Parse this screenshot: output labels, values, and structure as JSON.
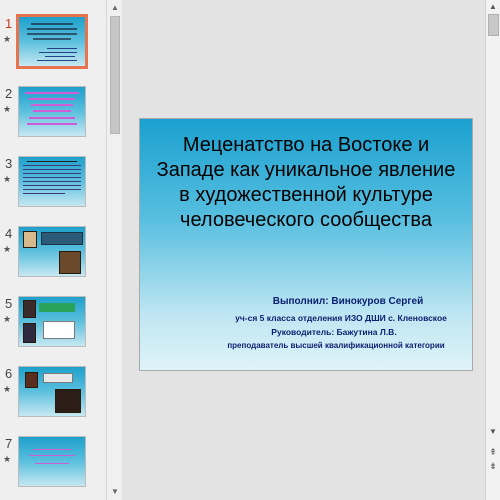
{
  "thumbnails": [
    {
      "number": "1",
      "star": "★",
      "active": true
    },
    {
      "number": "2",
      "star": "★",
      "active": false
    },
    {
      "number": "3",
      "star": "★",
      "active": false
    },
    {
      "number": "4",
      "star": "★",
      "active": false
    },
    {
      "number": "5",
      "star": "★",
      "active": false
    },
    {
      "number": "6",
      "star": "★",
      "active": false
    },
    {
      "number": "7",
      "star": "★",
      "active": false
    }
  ],
  "slide": {
    "title": "Меценатство на Востоке и Западе как уникальное явление в художественной культуре человеческого сообщества",
    "author": "Выполнил: Винокуров Сергей",
    "student_line": "уч-ся 5 класса  отделения  ИЗО  ДШИ с. Кленовское",
    "supervisor": "Руководитель: Бажутина Л.В.",
    "supervisor_role": "преподаватель высшей квалификационной категории"
  },
  "colors": {
    "active_thumb_border": "#e8744f",
    "active_number": "#c43b1d",
    "slide_gradient_top": "#1ba0cf",
    "slide_gradient_bottom": "#dff3f8",
    "subtitle_text": "#0a1f6e"
  },
  "icons": {
    "scroll_up": "▲",
    "scroll_down": "▼",
    "prev_slide": "⇞",
    "next_slide": "⇟"
  }
}
